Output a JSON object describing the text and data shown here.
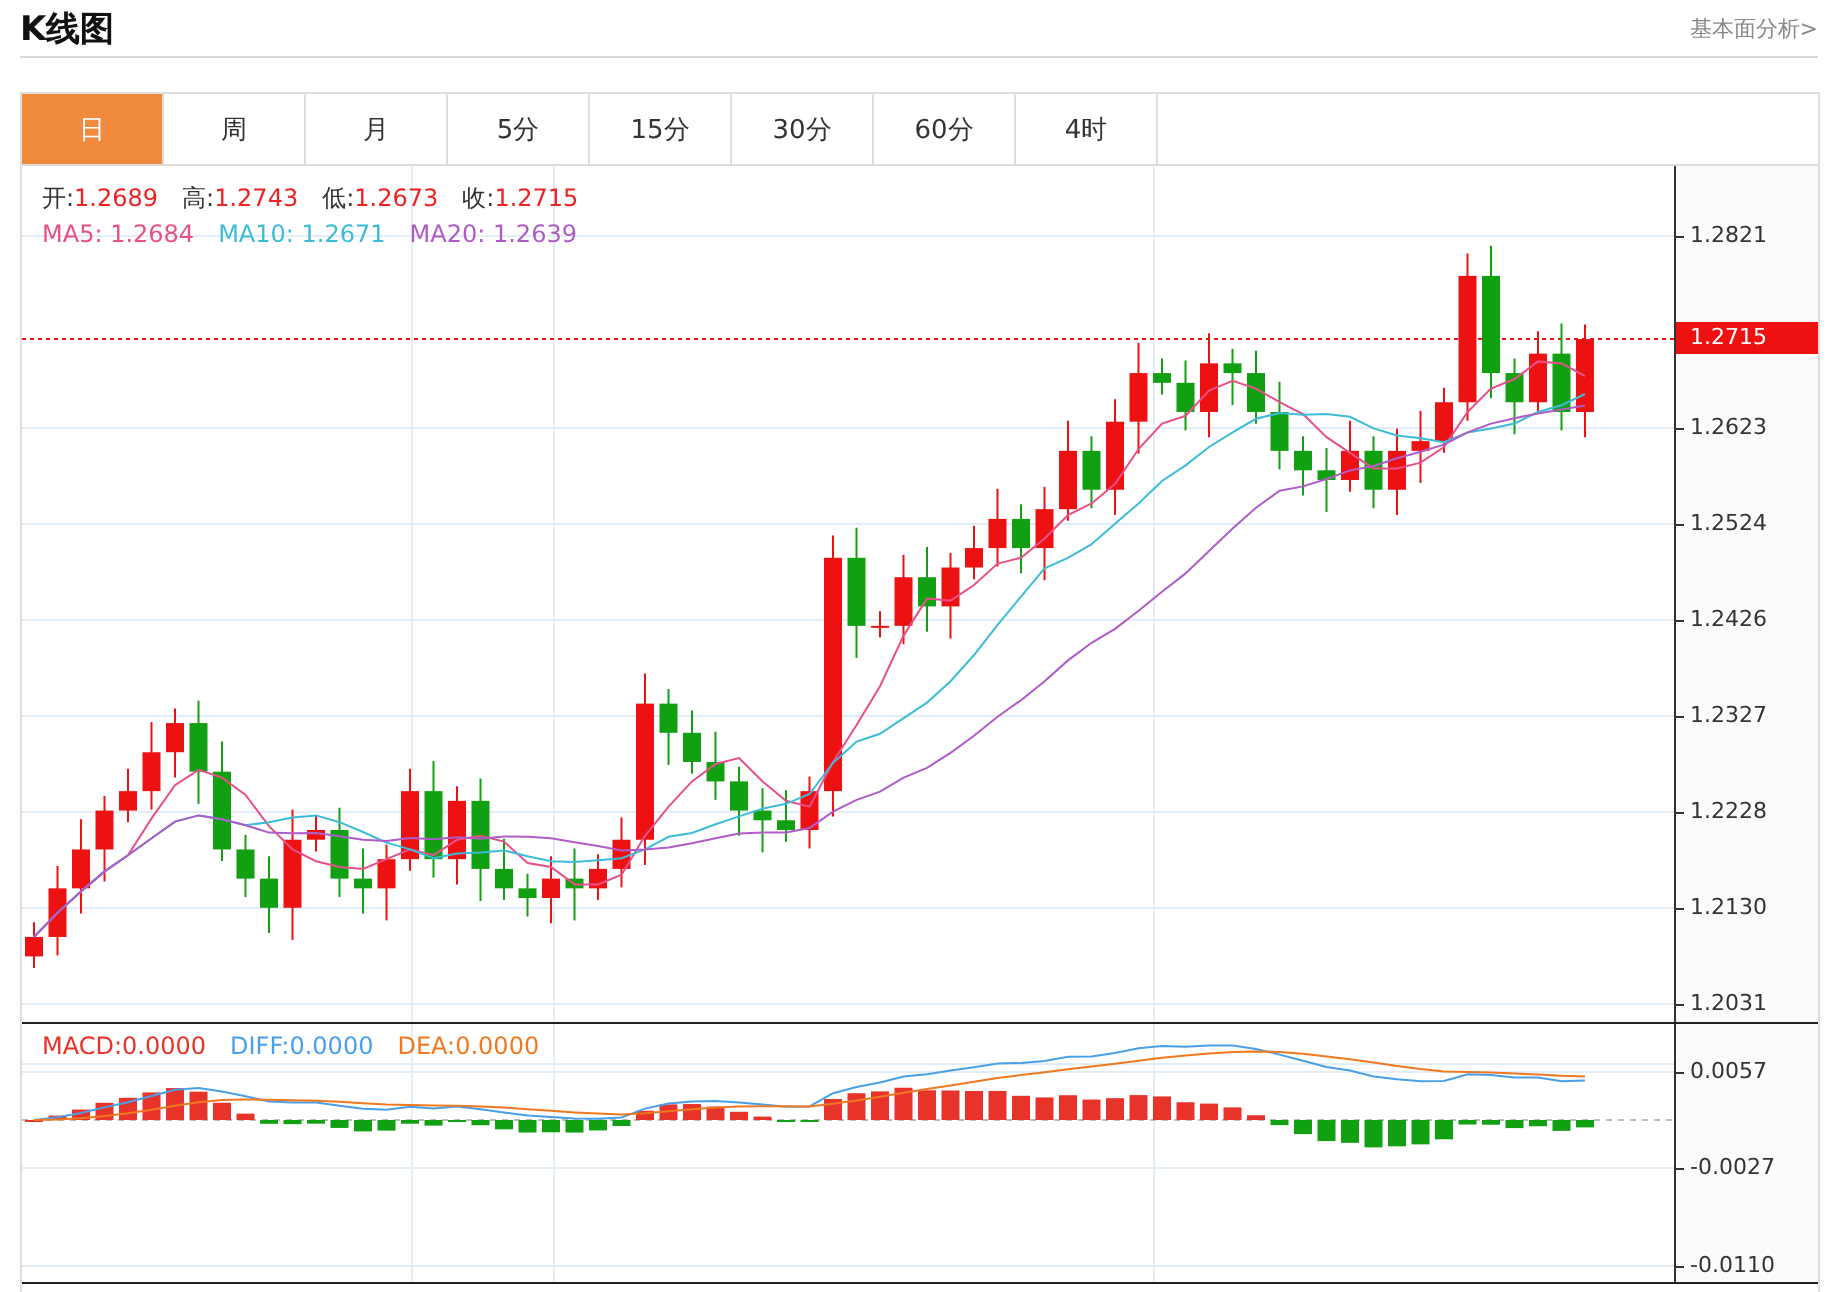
{
  "header": {
    "title": "K线图",
    "link": "基本面分析>"
  },
  "tabs": [
    {
      "label": "日",
      "selected": true
    },
    {
      "label": "周",
      "selected": false
    },
    {
      "label": "月",
      "selected": false
    },
    {
      "label": "5分",
      "selected": false
    },
    {
      "label": "15分",
      "selected": false
    },
    {
      "label": "30分",
      "selected": false
    },
    {
      "label": "60分",
      "selected": false
    },
    {
      "label": "4时",
      "selected": false
    }
  ],
  "quote": [
    {
      "label": "开:",
      "value": "1.2689"
    },
    {
      "label": "高:",
      "value": "1.2743"
    },
    {
      "label": "低:",
      "value": "1.2673"
    },
    {
      "label": "收:",
      "value": "1.2715"
    }
  ],
  "averages": [
    {
      "label": "MA5:",
      "value": "1.2684",
      "color": "#e8508a"
    },
    {
      "label": "MA10:",
      "value": "1.2671",
      "color": "#3cbcd8"
    },
    {
      "label": "MA20:",
      "value": "1.2639",
      "color": "#b05cc8"
    }
  ],
  "price_axis": {
    "ticks": [
      "1.2821",
      "1.2623",
      "1.2524",
      "1.2426",
      "1.2327",
      "1.2228",
      "1.2130",
      "1.2031"
    ],
    "current": "1.2715"
  },
  "macd_legend": [
    {
      "label": "MACD:",
      "value": "0.0000",
      "color": "#e8332a"
    },
    {
      "label": "DIFF:",
      "value": "0.0000",
      "color": "#4aa0e8"
    },
    {
      "label": "DEA:",
      "value": "0.0000",
      "color": "#f07820"
    }
  ],
  "macd_axis": {
    "ticks": [
      "0.0057",
      "-0.0027",
      "-0.0110"
    ]
  }
}
